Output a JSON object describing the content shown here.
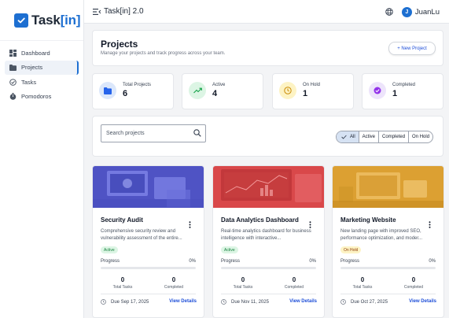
{
  "app": {
    "logo_main": "Task",
    "logo_accent": "[in]",
    "window_title": "Task[in] 2.0"
  },
  "user": {
    "initial": "J",
    "name": "JuanLu"
  },
  "sidebar": {
    "items": [
      {
        "label": "Dashboard",
        "icon": "dashboard-icon"
      },
      {
        "label": "Projects",
        "icon": "folder-icon",
        "active": true
      },
      {
        "label": "Tasks",
        "icon": "check-circle-icon"
      },
      {
        "label": "Pomodoros",
        "icon": "timer-icon"
      }
    ]
  },
  "header": {
    "title": "Projects",
    "subtitle": "Manage your projects and track progress across your team.",
    "new_button": "+ New Project"
  },
  "stats": [
    {
      "label": "Total Projects",
      "value": "6",
      "color": "#dbe7fb",
      "icon": "folder-icon"
    },
    {
      "label": "Active",
      "value": "4",
      "color": "#dcf5e4",
      "icon": "trending-up-icon"
    },
    {
      "label": "On Hold",
      "value": "1",
      "color": "#fdf3c4",
      "icon": "clock-icon"
    },
    {
      "label": "Completed",
      "value": "1",
      "color": "#ede4fb",
      "icon": "check-circle-icon"
    }
  ],
  "filters": {
    "search_placeholder": "Search projects",
    "segments": [
      "All",
      "Active",
      "Completed",
      "On Hold"
    ],
    "selected": "All"
  },
  "projects": [
    {
      "name": "Security Audit",
      "description": "Comprehensive security review and vulnerability assessment of the entire...",
      "status": "Active",
      "progress_label": "Progress",
      "progress": "0%",
      "total_tasks": "0",
      "total_tasks_label": "Total Tasks",
      "completed": "0",
      "completed_label": "Completed",
      "due": "Due Sep 17, 2025",
      "view": "View Details",
      "tint": "#5a5fcf"
    },
    {
      "name": "Data Analytics Dashboard",
      "description": "Real-time analytics dashboard for business intelligence with interactive...",
      "status": "Active",
      "progress_label": "Progress",
      "progress": "0%",
      "total_tasks": "0",
      "total_tasks_label": "Total Tasks",
      "completed": "0",
      "completed_label": "Completed",
      "due": "Due Nov 11, 2025",
      "view": "View Details",
      "tint": "#d9484a"
    },
    {
      "name": "Marketing Website",
      "description": "New landing page with improved SEO, performance optimization, and moder...",
      "status": "On Hold",
      "progress_label": "Progress",
      "progress": "0%",
      "total_tasks": "0",
      "total_tasks_label": "Total Tasks",
      "completed": "0",
      "completed_label": "Completed",
      "due": "Due Oct 27, 2025",
      "view": "View Details",
      "tint": "#e4a93a"
    }
  ],
  "colors": {
    "accent": "#1d6fd1",
    "active_badge_bg": "#dcf5e4",
    "active_badge_fg": "#15803d",
    "hold_badge_bg": "#fdf3c4",
    "hold_badge_fg": "#92400e"
  }
}
